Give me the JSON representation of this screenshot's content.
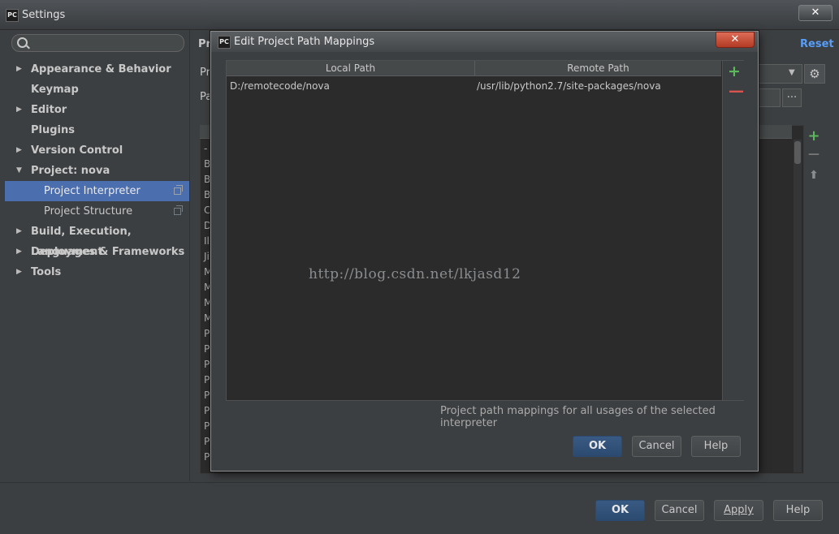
{
  "window": {
    "app_icon": "PC",
    "title": "Settings",
    "close": "✕"
  },
  "sidebar": {
    "items": [
      {
        "label": "Appearance & Behavior",
        "arrow": "▶"
      },
      {
        "label": "Keymap",
        "arrow": ""
      },
      {
        "label": "Editor",
        "arrow": "▶"
      },
      {
        "label": "Plugins",
        "arrow": ""
      },
      {
        "label": "Version Control",
        "arrow": "▶"
      },
      {
        "label": "Project: nova",
        "arrow": "▼"
      },
      {
        "label": "Project Interpreter",
        "arrow": ""
      },
      {
        "label": "Project Structure",
        "arrow": ""
      },
      {
        "label": "Build, Execution, Deployment",
        "arrow": "▶"
      },
      {
        "label": "Languages & Frameworks",
        "arrow": "▶"
      },
      {
        "label": "Tools",
        "arrow": "▶"
      }
    ],
    "selected": "Project Interpreter"
  },
  "content": {
    "header_partial": "Pr",
    "row1_partial": "Pr",
    "row2_partial": "Pa",
    "reset": "Reset",
    "gear_icon": "gear-icon",
    "more_button": "...",
    "package_letters": [
      "-",
      "B",
      "B",
      "B",
      "C",
      "D",
      "Il",
      "Ji",
      "M",
      "M",
      "M",
      "M",
      "P",
      "P",
      "P",
      "P",
      "P",
      "P",
      "P",
      "P",
      "P"
    ],
    "side_tools": {
      "add": "+",
      "remove": "—",
      "upgrade": "⬆"
    }
  },
  "dialog": {
    "app_icon": "PC",
    "title": "Edit Project Path Mappings",
    "close": "✕",
    "columns": [
      "Local Path",
      "Remote Path"
    ],
    "rows": [
      {
        "local": "D:/remotecode/nova",
        "remote": "/usr/lib/python2.7/site-packages/nova"
      }
    ],
    "add_tool": "+",
    "remove_tool": "—",
    "info": "Project path mappings for all usages of the selected interpreter",
    "ok": "OK",
    "cancel": "Cancel",
    "help": "Help"
  },
  "footer": {
    "ok": "OK",
    "cancel": "Cancel",
    "apply": "Apply",
    "help": "Help"
  },
  "watermark": "http://blog.csdn.net/lkjasd12",
  "colors": {
    "background": "#3c3f41",
    "selection": "#4b6eaf",
    "accent_link": "#589df6",
    "add_green": "#5cb85c",
    "remove_red": "#d9534f"
  }
}
